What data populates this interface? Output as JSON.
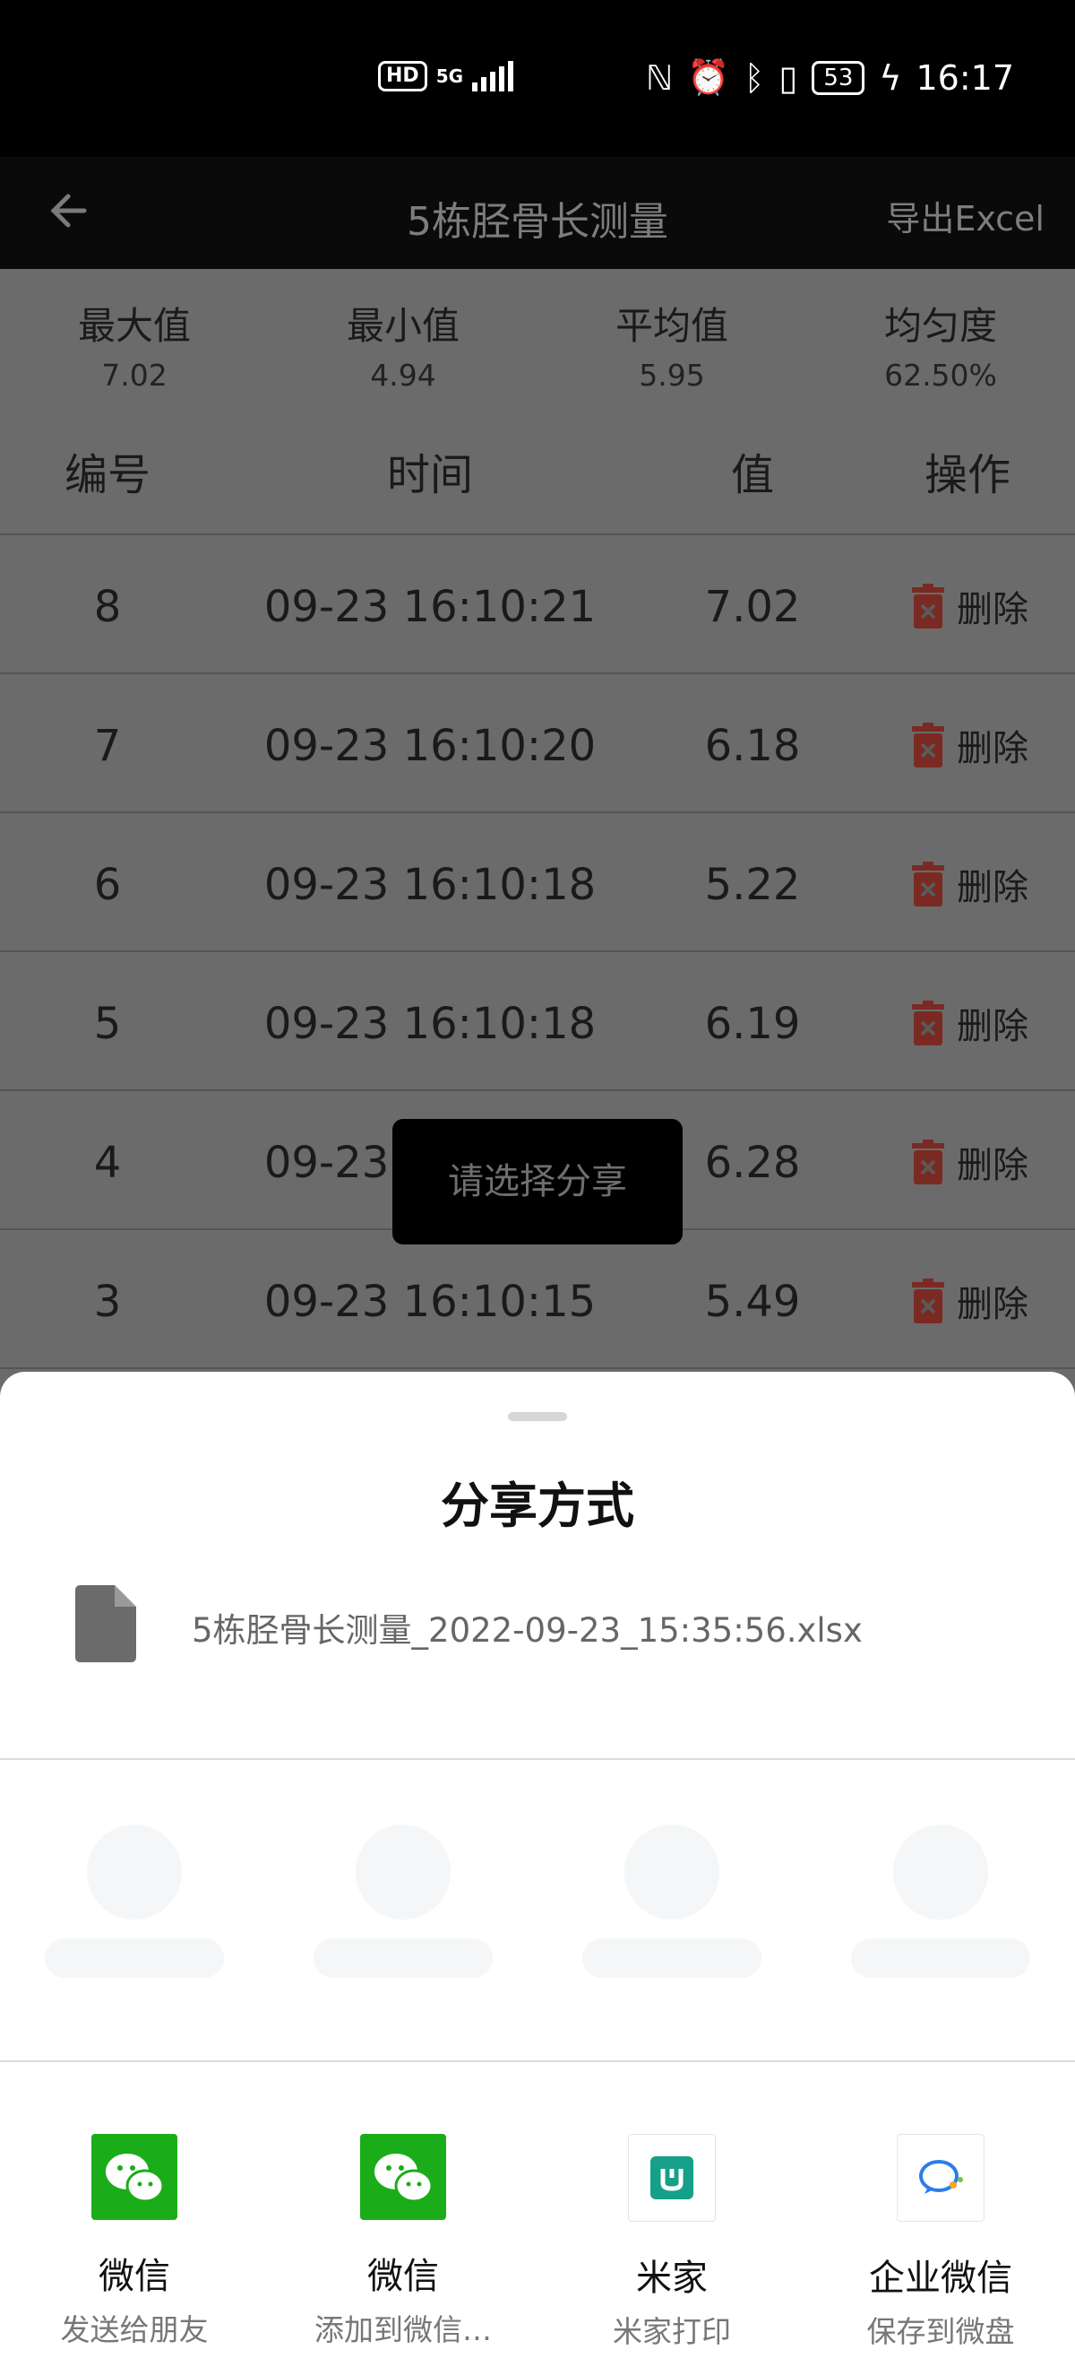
{
  "status_bar": {
    "hd": "HD",
    "network": "5G",
    "battery": "53",
    "time": "16:17"
  },
  "app_bar": {
    "title": "5栋胫骨长测量",
    "export_label": "导出Excel"
  },
  "stats": [
    {
      "label": "最大值",
      "value": "7.02"
    },
    {
      "label": "最小值",
      "value": "4.94"
    },
    {
      "label": "平均值",
      "value": "5.95"
    },
    {
      "label": "均匀度",
      "value": "62.50%"
    }
  ],
  "table": {
    "headers": [
      "编号",
      "时间",
      "值",
      "操作"
    ],
    "delete_label": "删除",
    "rows": [
      {
        "num": "8",
        "time": "09-23 16:10:21",
        "value": "7.02"
      },
      {
        "num": "7",
        "time": "09-23 16:10:20",
        "value": "6.18"
      },
      {
        "num": "6",
        "time": "09-23 16:10:18",
        "value": "5.22"
      },
      {
        "num": "5",
        "time": "09-23 16:10:18",
        "value": "6.19"
      },
      {
        "num": "4",
        "time": "09-23 16:10:16",
        "value": "6.28"
      },
      {
        "num": "3",
        "time": "09-23 16:10:15",
        "value": "5.49"
      }
    ]
  },
  "toast": "请选择分享",
  "sheet": {
    "title": "分享方式",
    "file_name": "5栋胫骨长测量_2022-09-23_15:35:56.xlsx",
    "apps": [
      {
        "name": "微信",
        "sub": "发送给朋友",
        "icon": "wechat-icon",
        "color": "#1aad19"
      },
      {
        "name": "微信",
        "sub": "添加到微信…",
        "icon": "wechat-icon",
        "color": "#1aad19"
      },
      {
        "name": "米家",
        "sub": "米家打印",
        "icon": "mijia-icon",
        "color": "#16a08a"
      },
      {
        "name": "企业微信",
        "sub": "保存到微盘",
        "icon": "wecom-icon",
        "color": "#2b7de9"
      }
    ]
  }
}
